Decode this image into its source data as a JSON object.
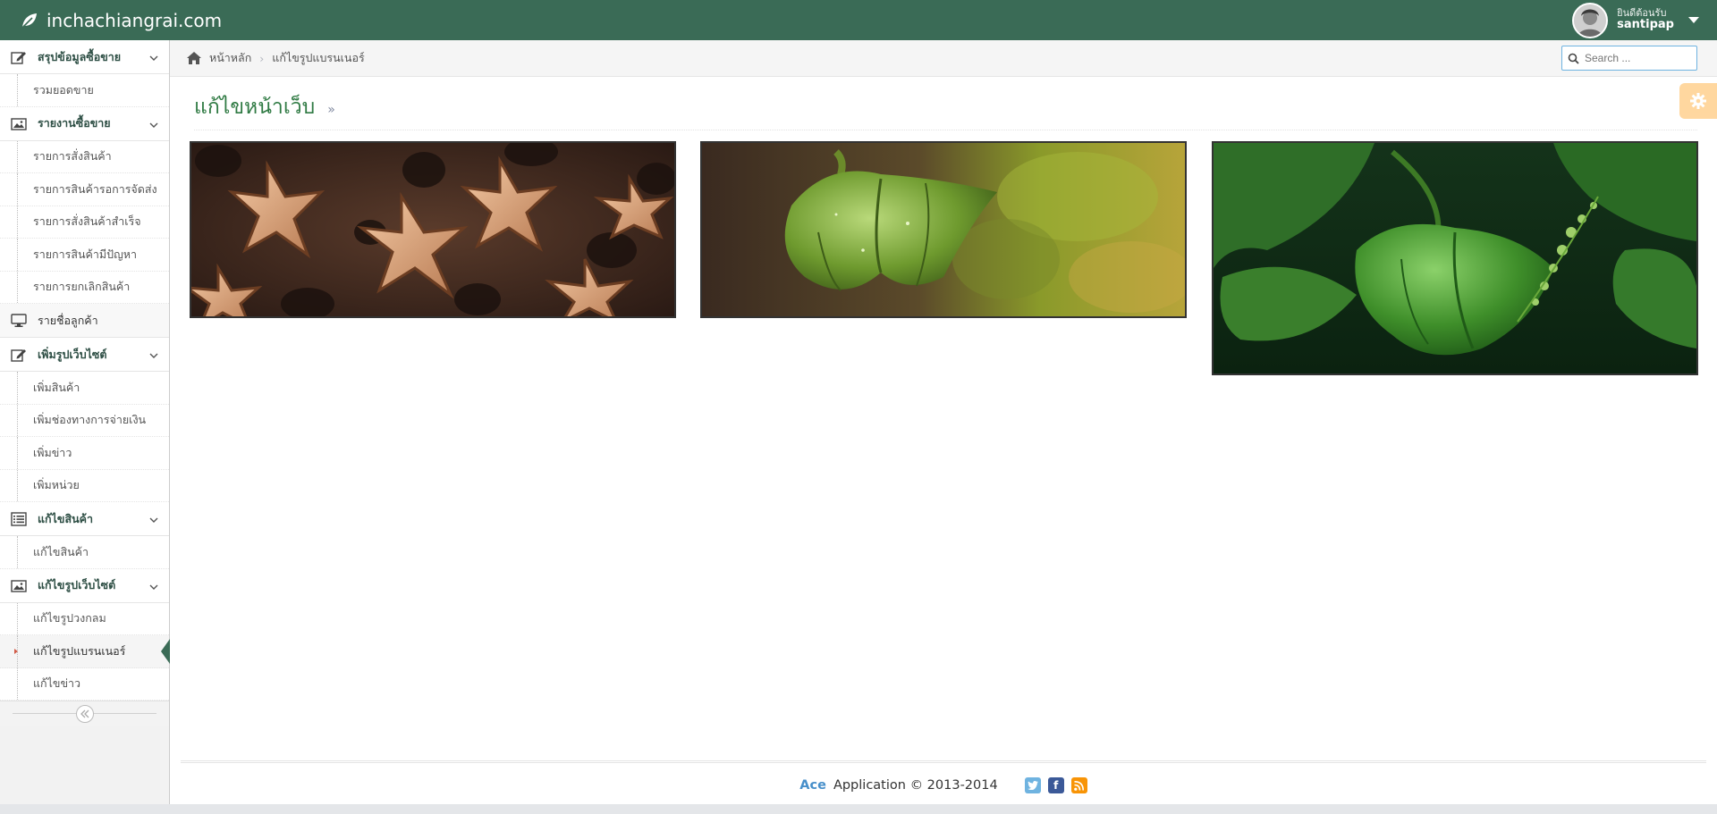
{
  "navbar": {
    "brand": "inchachiangrai.com",
    "welcome": "ยินดีต้อนรับ",
    "username": "santipap"
  },
  "sidebar": {
    "groups": [
      {
        "title": "สรุปข้อมูลซื้อขาย",
        "icon": "edit-icon",
        "items": [
          "รวมยอดขาย"
        ]
      },
      {
        "title": "รายงานซื้อขาย",
        "icon": "picture-icon",
        "items": [
          "รายการสั่งสินค้า",
          "รายการสินค้ารอการจัดส่ง",
          "รายการสั่งสินค้าสำเร็จ",
          "รายการสินค้ามีปัญหา",
          "รายการยกเลิกสินค้า"
        ]
      },
      {
        "title": "รายชื่อลูกค้า",
        "icon": "desktop-icon",
        "items": []
      },
      {
        "title": "เพิ่มรูปเว็บไซต์",
        "icon": "edit-icon",
        "items": [
          "เพิ่มสินค้า",
          "เพิ่มช่องทางการจ่ายเงิน",
          "เพิ่มข่าว",
          "เพิ่มหน่วย"
        ]
      },
      {
        "title": "แก้ไขสินค้า",
        "icon": "list-icon",
        "items": [
          "แก้ไขสินค้า"
        ]
      },
      {
        "title": "แก้ไขรูปเว็บไซต์",
        "icon": "picture-icon",
        "items": [
          "แก้ไขรูปวงกลม",
          "แก้ไขรูปแบรนเนอร์",
          "แก้ไขข่าว"
        ]
      }
    ],
    "active_item": "แก้ไขรูปแบรนเนอร์"
  },
  "breadcrumb": {
    "home": "หน้าหลัก",
    "current": "แก้ไขรูปแบรนเนอร์"
  },
  "search": {
    "placeholder": "Search ..."
  },
  "page": {
    "title": "แก้ไขหน้าเว็บ",
    "title_suffix": "»"
  },
  "banners": [
    {
      "name": "sacha-inchi-seeds-banner"
    },
    {
      "name": "green-pod-banner"
    },
    {
      "name": "green-fruit-leaves-banner"
    }
  ],
  "footer": {
    "brand": "Ace",
    "text": "Application © 2013-2014"
  },
  "colors": {
    "navbar": "#3a6b56",
    "title": "#2f7a43",
    "settings": "#ffb752"
  }
}
